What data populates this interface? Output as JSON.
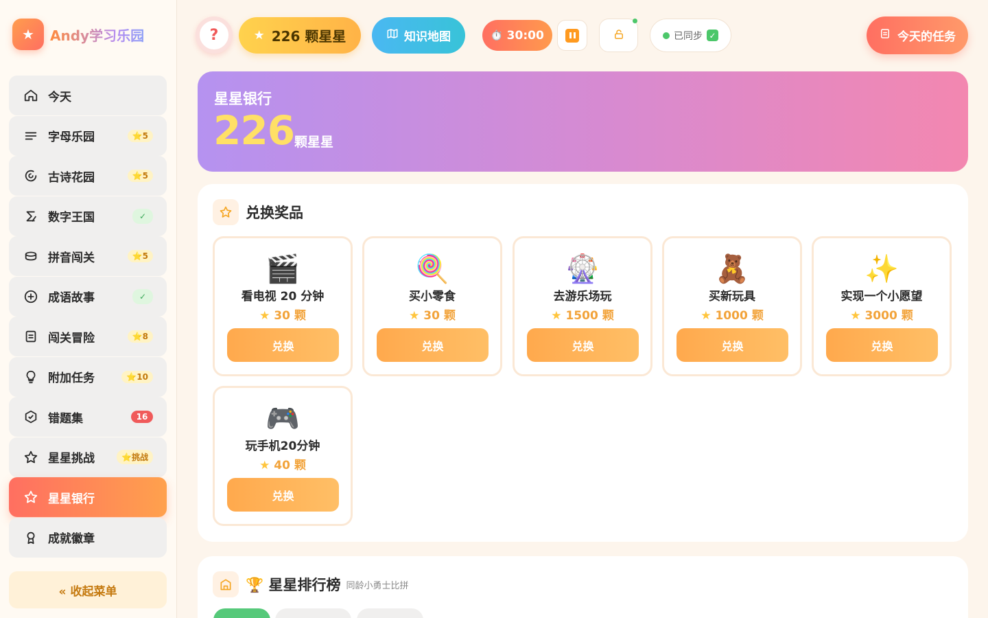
{
  "brand": {
    "logo_icon": "star-icon",
    "name": "Andy学习乐园"
  },
  "sidebar": {
    "items": [
      {
        "label": "今天",
        "icon": "home-icon",
        "badge": ""
      },
      {
        "label": "字母乐园",
        "icon": "lines-icon",
        "badge": "⭐5",
        "badge_type": "star"
      },
      {
        "label": "古诗花园",
        "icon": "swirl-icon",
        "badge": "⭐5",
        "badge_type": "star"
      },
      {
        "label": "数字王国",
        "icon": "sigma-icon",
        "badge": "✓",
        "badge_type": "check"
      },
      {
        "label": "拼音闯关",
        "icon": "bowl-icon",
        "badge": "⭐5",
        "badge_type": "star"
      },
      {
        "label": "成语故事",
        "icon": "plus-circle-icon",
        "badge": "✓",
        "badge_type": "check"
      },
      {
        "label": "闯关冒险",
        "icon": "document-icon",
        "badge": "⭐8",
        "badge_type": "star"
      },
      {
        "label": "附加任务",
        "icon": "bulb-icon",
        "badge": "⭐10",
        "badge_type": "star"
      },
      {
        "label": "错题集",
        "icon": "shield-check-icon",
        "badge": "16",
        "badge_type": "red"
      },
      {
        "label": "星星挑战",
        "icon": "star-outline-icon",
        "badge": "⭐挑战",
        "badge_type": "star"
      },
      {
        "label": "星星银行",
        "icon": "star-outline-icon",
        "badge": "",
        "active": true
      },
      {
        "label": "成就徽章",
        "icon": "ribbon-icon",
        "badge": ""
      }
    ],
    "collapse_label": "« 收起菜单"
  },
  "topbar": {
    "help_label": "?",
    "stars_label": "226 颗星星",
    "map_label": "知识地图",
    "timer_label": "30:00",
    "timer_icon": "⏱️",
    "sync_label": "已同步",
    "sync_check": "✓",
    "tasks_label": "今天的任务"
  },
  "bank": {
    "title": "星星银行",
    "amount": "226",
    "unit": "颗星星"
  },
  "rewards": {
    "title": "兑换奖品",
    "redeem_label": "兑换",
    "items": [
      {
        "emoji": "🎬",
        "name": "看电视 20 分钟",
        "price": "30 颗"
      },
      {
        "emoji": "🍭",
        "name": "买小零食",
        "price": "30 颗"
      },
      {
        "emoji": "🎡",
        "name": "去游乐场玩",
        "price": "1500 颗"
      },
      {
        "emoji": "🧸",
        "name": "买新玩具",
        "price": "1000 颗"
      },
      {
        "emoji": "✨",
        "name": "实现一个小愿望",
        "price": "3000 颗"
      },
      {
        "emoji": "🎮",
        "name": "玩手机20分钟",
        "price": "40 颗"
      }
    ]
  },
  "leaderboard": {
    "title": "🏆 星星排行榜",
    "subtitle": "同龄小勇士比拼"
  },
  "colors": {
    "accent": "#ff6f61",
    "star": "#ffc53d",
    "bank_gradient_start": "#b592f0",
    "bank_gradient_end": "#f387b0"
  }
}
